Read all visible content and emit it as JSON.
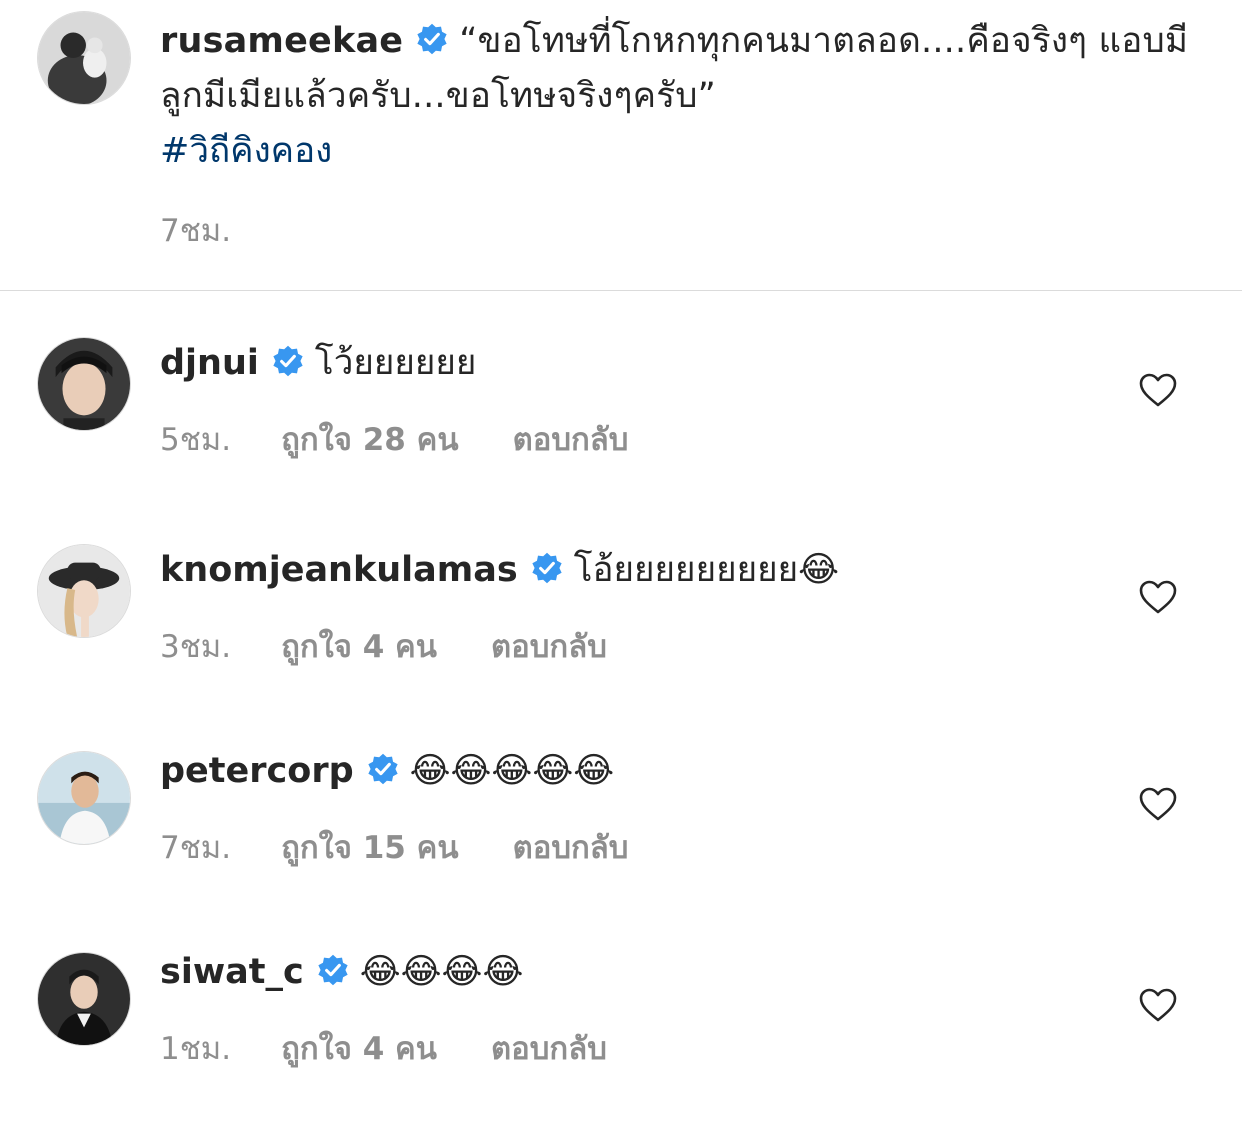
{
  "caption": {
    "username": "rusameekae",
    "text": "“ขอโทษที่โกหกทุกคนมาตลอด....คือจริงๆ แอบมีลูกมีเมียแล้วครับ...ขอโทษจริงๆครับ”",
    "hashtag": "#วิถีคิงคอง",
    "time": "7ชม."
  },
  "comments": [
    {
      "username": "djnui",
      "text": "โว้ยยยยยย",
      "time": "5ชม.",
      "likes": "ถูกใจ 28 คน",
      "reply": "ตอบกลับ"
    },
    {
      "username": "knomjeankulamas",
      "text": "โอ้ยยยยยยยยย😂",
      "time": "3ชม.",
      "likes": "ถูกใจ 4 คน",
      "reply": "ตอบกลับ"
    },
    {
      "username": "petercorp",
      "text": "😂😂😂😂😂",
      "time": "7ชม.",
      "likes": "ถูกใจ 15 คน",
      "reply": "ตอบกลับ"
    },
    {
      "username": "siwat_c",
      "text": "😂😂😂😂",
      "time": "1ชม.",
      "likes": "ถูกใจ 4 คน",
      "reply": "ตอบกลับ"
    }
  ],
  "icons": {
    "verified": "verified-badge-icon",
    "heart": "heart-outline-icon"
  },
  "colors": {
    "verified_blue": "#3897f0",
    "hashtag_blue": "#00376b",
    "meta_gray": "#8e8e8e",
    "text": "#262626",
    "divider": "#dbdbdb"
  }
}
